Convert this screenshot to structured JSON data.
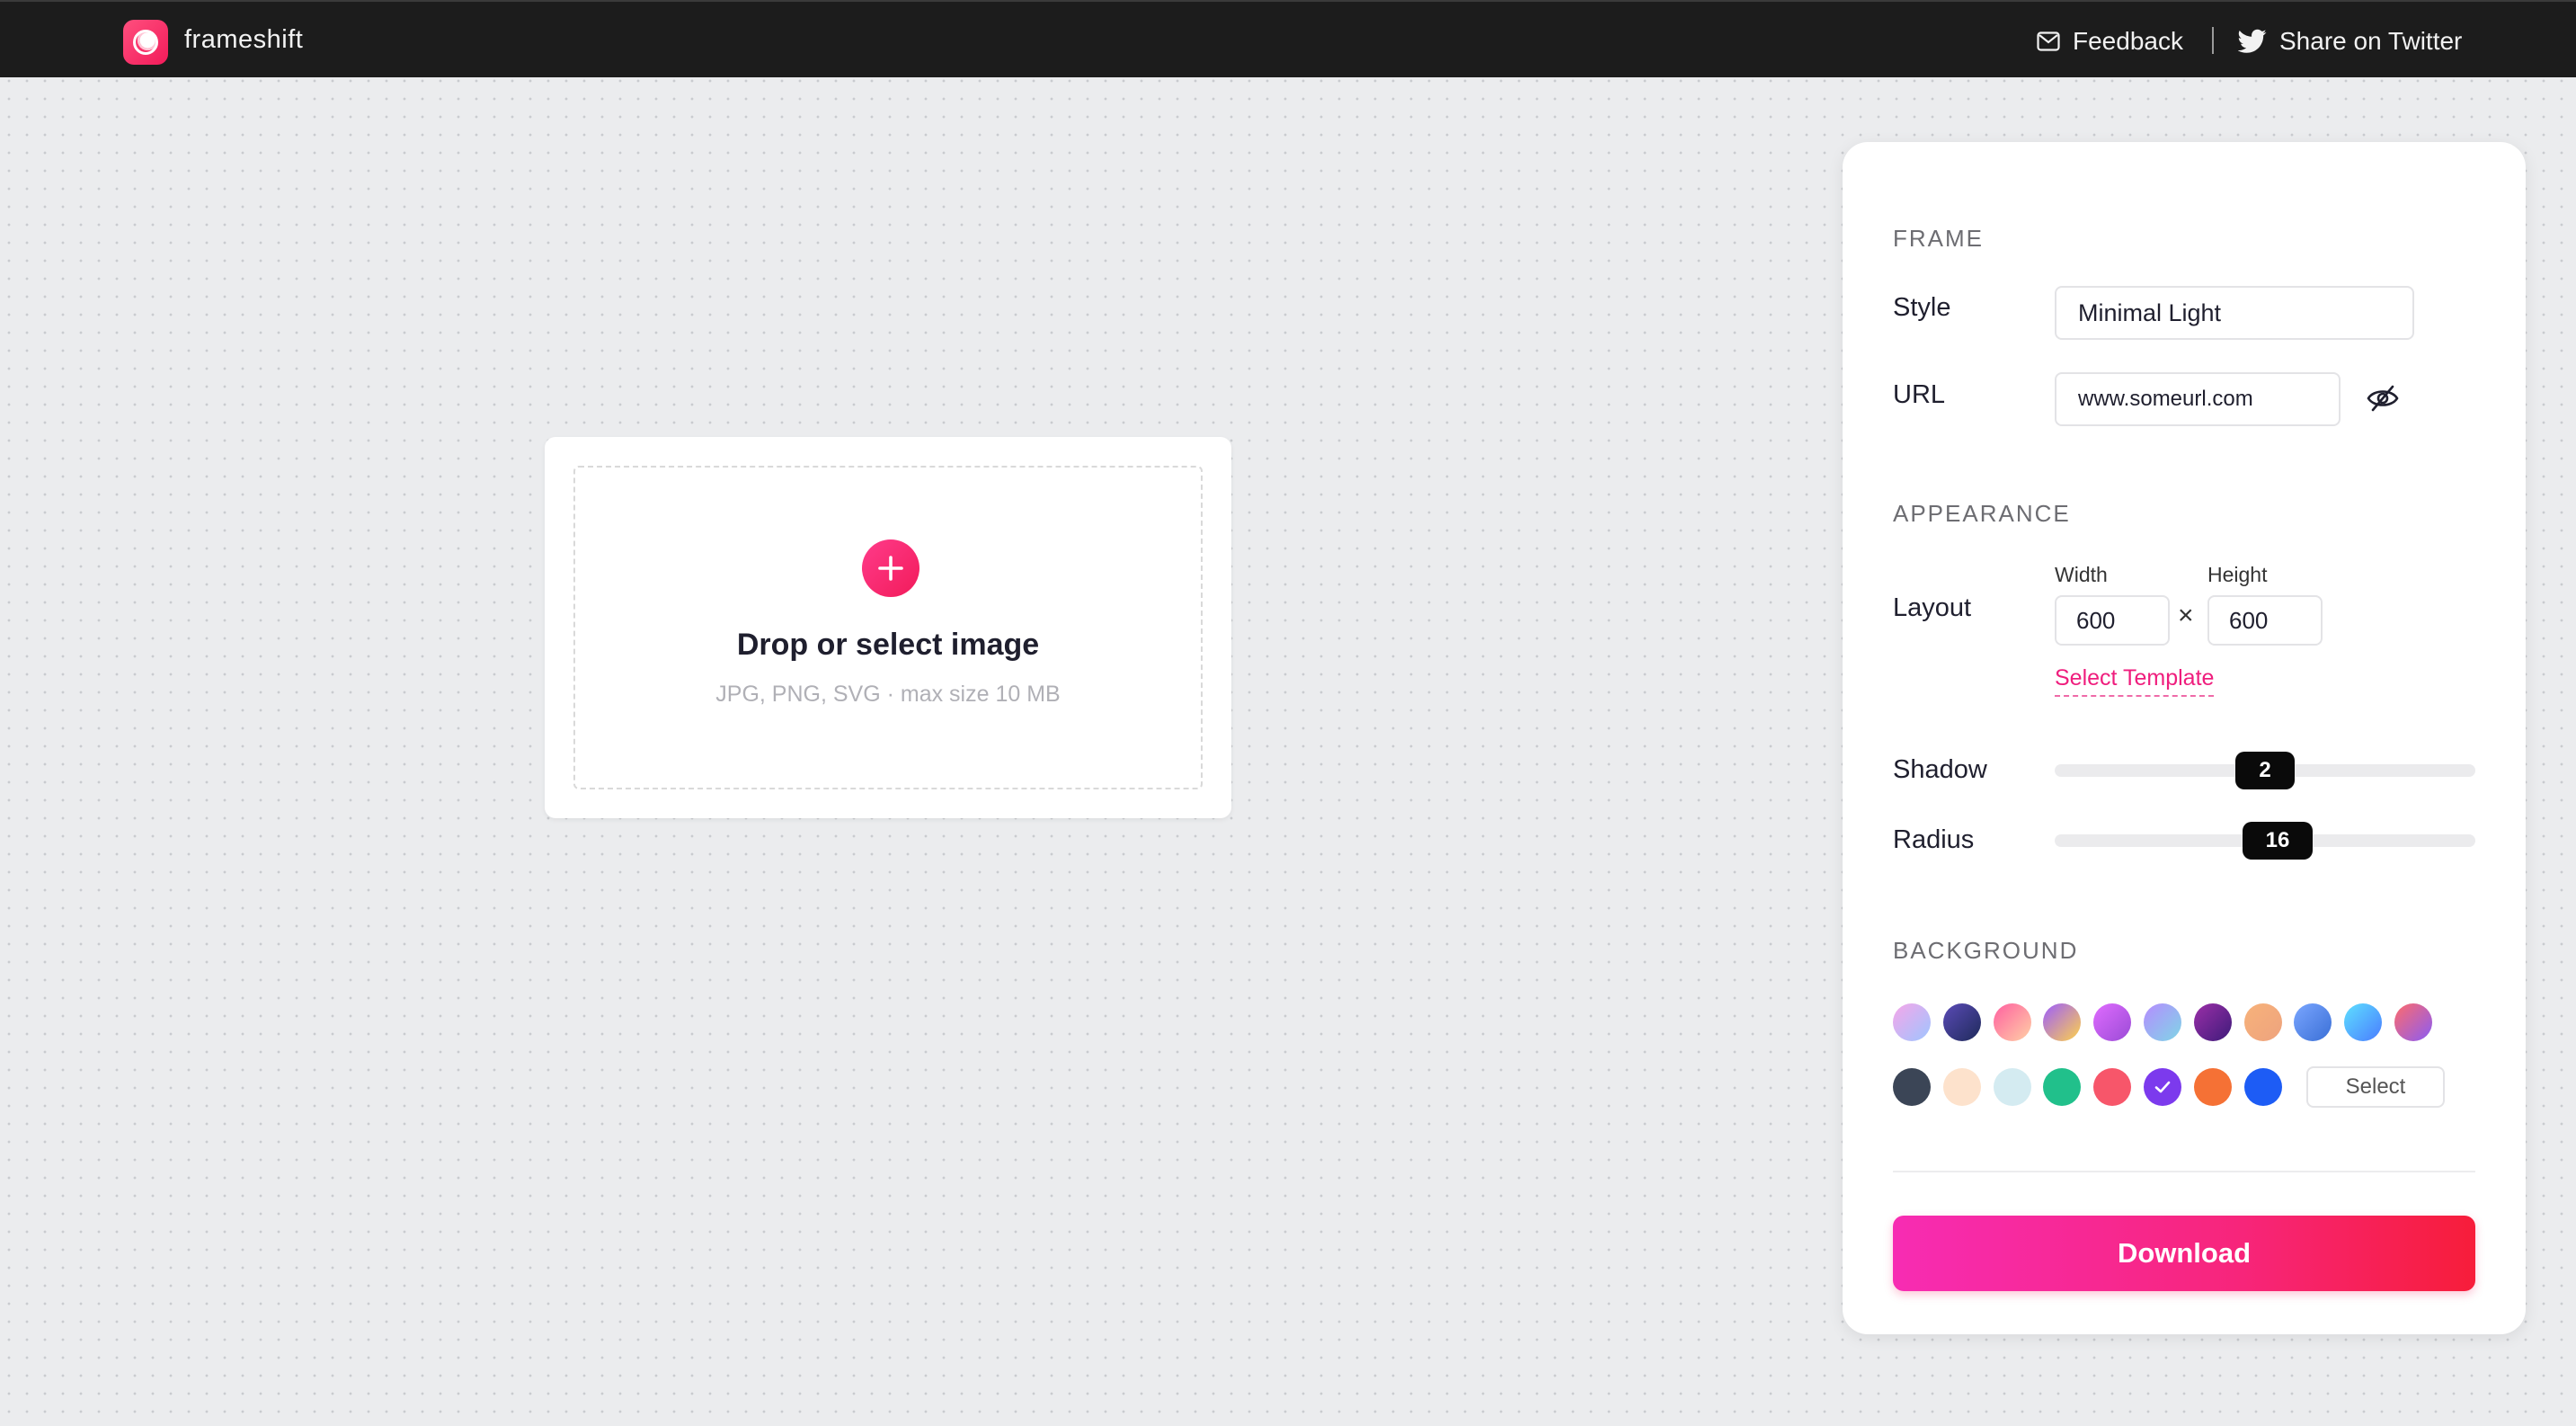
{
  "header": {
    "brand": "frameshift",
    "feedback_label": "Feedback",
    "share_label": "Share on Twitter"
  },
  "upload": {
    "title": "Drop or select image",
    "hint": "JPG, PNG, SVG · max size 10 MB"
  },
  "panel": {
    "frame": {
      "section_title": "FRAME",
      "style_label": "Style",
      "style_value": "Minimal Light",
      "url_label": "URL",
      "url_value": "www.someurl.com"
    },
    "appearance": {
      "section_title": "APPEARANCE",
      "layout_label": "Layout",
      "width_label": "Width",
      "width_value": "600",
      "height_label": "Height",
      "height_value": "600",
      "times_symbol": "×",
      "template_link": "Select Template",
      "shadow_label": "Shadow",
      "shadow_value": "2",
      "shadow_fraction": 0.5,
      "radius_label": "Radius",
      "radius_value": "16",
      "radius_fraction": 0.53
    },
    "background": {
      "section_title": "BACKGROUND",
      "gradient_swatches": [
        "linear-gradient(135deg,#f6a6e9,#9ec5ff)",
        "linear-gradient(135deg,#5b4bb7,#1e2a5a)",
        "linear-gradient(135deg,#ff5fa0,#ffd1a6)",
        "linear-gradient(135deg,#9b5cff,#ffd24a)",
        "linear-gradient(135deg,#e06cff,#9a4bd6)",
        "linear-gradient(135deg,#b58cff,#7fd6e6)",
        "linear-gradient(135deg,#9b2fa8,#3e1b7a)",
        "linear-gradient(135deg,#f7b27a,#eea37e)",
        "linear-gradient(135deg,#7aa6ff,#3a6fd6)",
        "linear-gradient(135deg,#5ee0ff,#4a7cff)",
        "linear-gradient(135deg,#ff6b6b,#8a5cf5)"
      ],
      "solid_swatches": [
        "#3b4556",
        "#fde2cc",
        "#d4ebf1",
        "#21c08b",
        "#f7566a",
        "#7c3aed",
        "#f57135",
        "#1d5cf5"
      ],
      "selected_solid_index": 5,
      "select_label": "Select"
    },
    "download_label": "Download"
  }
}
